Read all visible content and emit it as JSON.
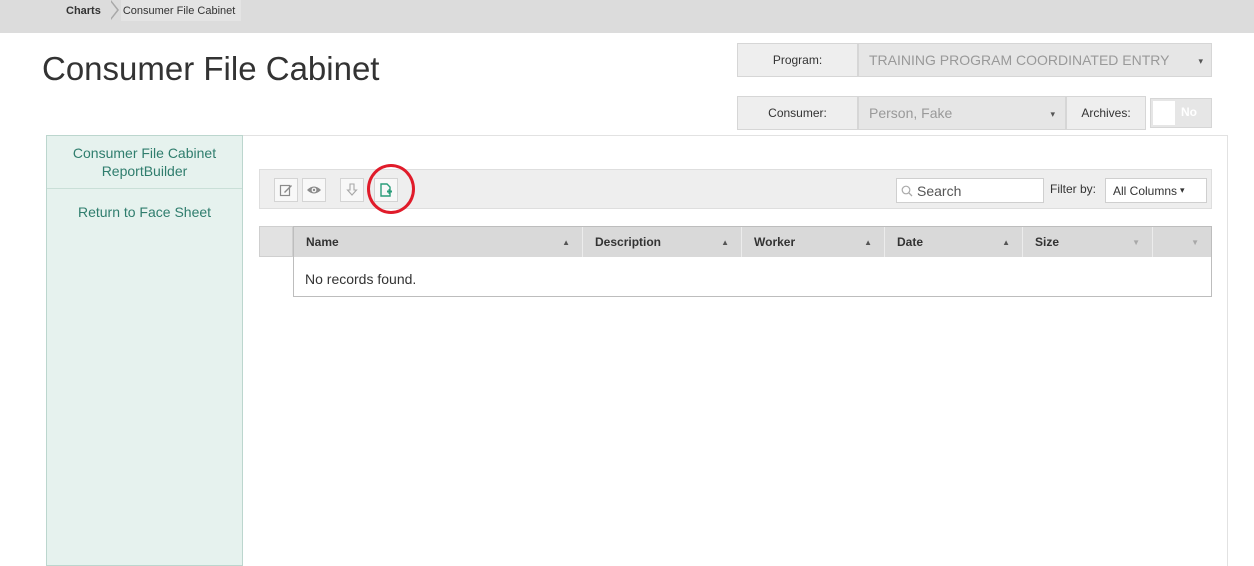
{
  "breadcrumb": {
    "items": [
      "Charts",
      "Consumer File Cabinet"
    ]
  },
  "page": {
    "title": "Consumer File Cabinet"
  },
  "program": {
    "label": "Program:",
    "value": "TRAINING PROGRAM COORDINATED ENTRY"
  },
  "consumer": {
    "label": "Consumer:",
    "value": "Person, Fake"
  },
  "archives": {
    "label": "Archives:",
    "value": "No"
  },
  "sidebar": {
    "items": [
      {
        "label": "Consumer File Cabinet ReportBuilder"
      },
      {
        "label": "Return to Face Sheet"
      }
    ]
  },
  "toolbar": {
    "buttons": [
      {
        "icon": "edit-icon"
      },
      {
        "icon": "eye-icon"
      },
      {
        "icon": "download-icon"
      },
      {
        "icon": "add-file-icon"
      }
    ],
    "search_placeholder": "Search",
    "filter_label": "Filter by:",
    "filter_value": "All Columns"
  },
  "table": {
    "columns": [
      "Name",
      "Description",
      "Worker",
      "Date",
      "Size"
    ],
    "empty_message": "No records found."
  },
  "colors": {
    "accent": "#2f7d6d",
    "highlight": "#e01b2a",
    "sidebar_bg": "#e6f2ee"
  }
}
